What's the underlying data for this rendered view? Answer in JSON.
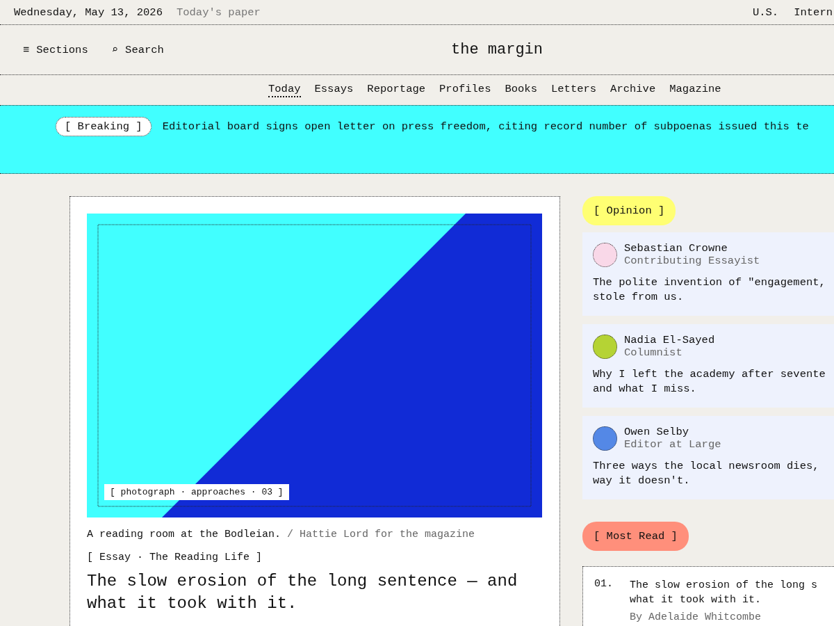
{
  "topbar": {
    "date": "Wednesday, May 13, 2026",
    "paper_link": "Today's paper",
    "editions": [
      "U.S.",
      "Intern"
    ]
  },
  "header": {
    "sections": {
      "icon": "≡",
      "label": "Sections"
    },
    "search": {
      "icon": "⌕",
      "label": "Search"
    },
    "title": "the margin"
  },
  "nav": [
    {
      "label": "Today",
      "selected": true
    },
    {
      "label": "Essays",
      "selected": false
    },
    {
      "label": "Reportage",
      "selected": false
    },
    {
      "label": "Profiles",
      "selected": false
    },
    {
      "label": "Books",
      "selected": false
    },
    {
      "label": "Letters",
      "selected": false
    },
    {
      "label": "Archive",
      "selected": false
    },
    {
      "label": "Magazine",
      "selected": false
    }
  ],
  "breaking": {
    "tag": "[ Breaking ]",
    "text": "Editorial board signs open letter on press freedom, citing record number of subpoenas issued this te"
  },
  "lead": {
    "image": {
      "kind": "picture",
      "caption_tag": "[ photograph · approaches · 03 ]"
    },
    "caption": "A reading room at the Bodleian.",
    "credit": "/ Hattie Lord for the magazine",
    "kicker": "[ Essay · The Reading Life ]",
    "headline": "The slow erosion of the long sentence — and what it took with it."
  },
  "opinion": {
    "label": "[ Opinion ]",
    "items": [
      {
        "name": "Sebastian Crowne",
        "role": "Contributing Essayist",
        "color": "#f9d8e8",
        "text": "The polite invention of \"engagement,\nstole from us."
      },
      {
        "name": "Nadia El-Sayed",
        "role": "Columnist",
        "color": "#b5d334",
        "text": "Why I left the academy after sevente\nand what I miss."
      },
      {
        "name": "Owen Selby",
        "role": "Editor at Large",
        "color": "#5488e6",
        "text": "Three ways the local newsroom dies,\nway it doesn't."
      }
    ]
  },
  "most_read": {
    "label": "[ Most Read ]",
    "items": [
      {
        "rank": "01.",
        "title": "The slow erosion of the long s\nwhat it took with it.",
        "byline": "By Adelaide Whitcombe"
      }
    ]
  }
}
